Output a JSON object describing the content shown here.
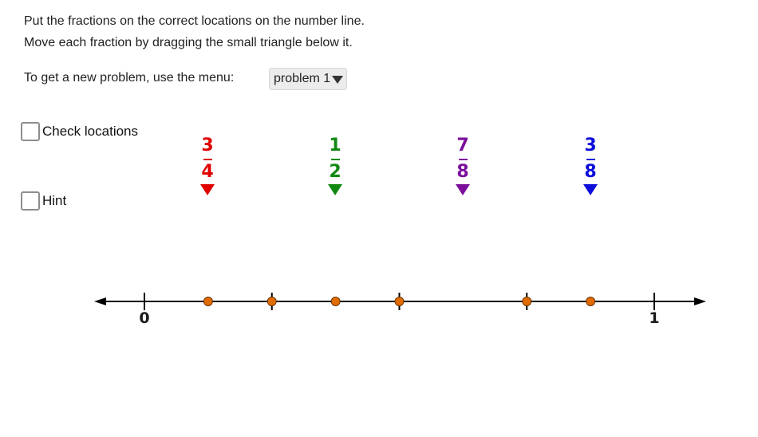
{
  "instructions": {
    "line1": "Put the fractions on the correct locations on the number line.",
    "line2": "Move each fraction by dragging the small triangle below it.",
    "line3": "To get a new problem, use the menu:"
  },
  "problem_menu": {
    "selected": "problem 1"
  },
  "checkboxes": {
    "check_locations": {
      "label": "Check locations",
      "checked": false
    },
    "hint": {
      "label": "Hint",
      "checked": false
    }
  },
  "number_line": {
    "min": 0,
    "max": 1,
    "min_label": "0",
    "max_label": "1",
    "tick_values": [
      0,
      0.25,
      0.5,
      0.75,
      1
    ],
    "point_values": [
      0.125,
      0.25,
      0.375,
      0.5,
      0.75,
      0.875
    ],
    "point_color": "#e06c00",
    "line_color": "#000000"
  },
  "fractions": [
    {
      "numerator": "3",
      "denominator": "4",
      "color": "#e00000",
      "slot": 1
    },
    {
      "numerator": "1",
      "denominator": "2",
      "color": "#118811",
      "slot": 3
    },
    {
      "numerator": "7",
      "denominator": "8",
      "color": "#7b0f9c",
      "slot": 5
    },
    {
      "numerator": "3",
      "denominator": "8",
      "color": "#0d0ddc",
      "slot": 7
    }
  ]
}
